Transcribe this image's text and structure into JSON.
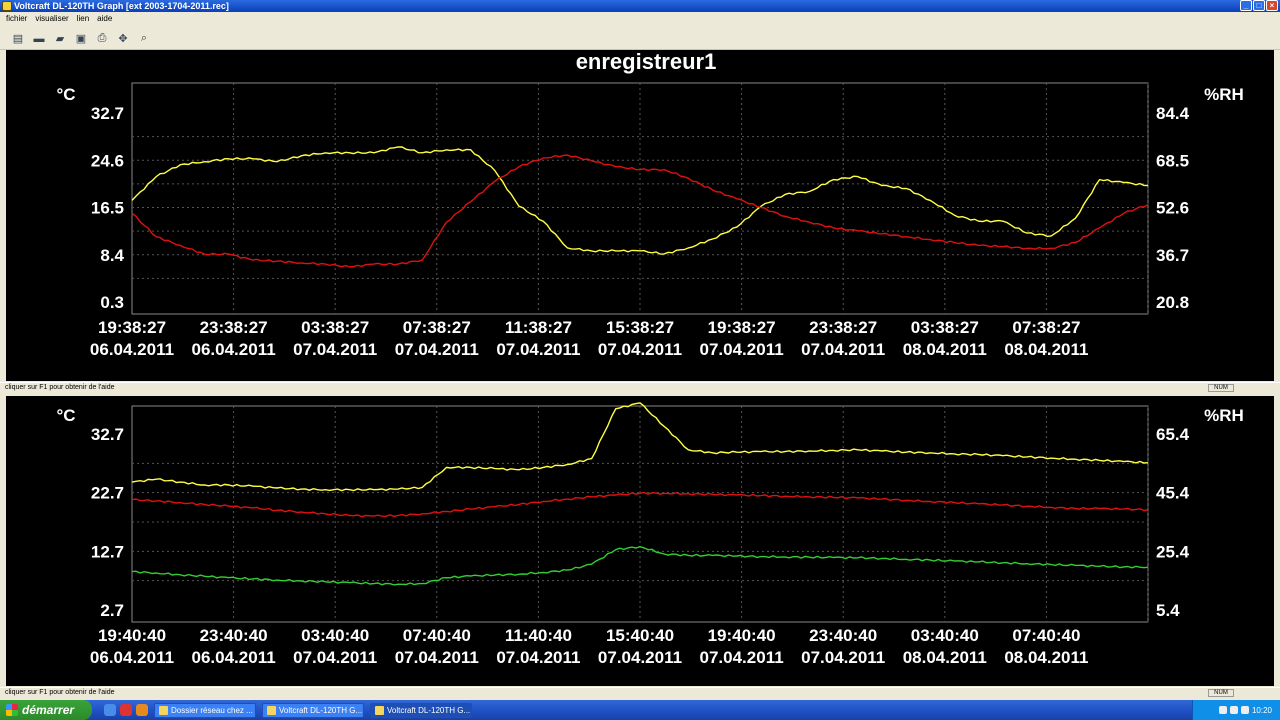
{
  "window": {
    "title": "Voltcraft DL-120TH Graph [ext 2003-1704-2011.rec]"
  },
  "menu": [
    "fichier",
    "visualiser",
    "lien",
    "aide"
  ],
  "toolbar": [
    {
      "name": "new-icon",
      "glyph": "▤"
    },
    {
      "name": "monitor-icon",
      "glyph": "▬"
    },
    {
      "name": "folder-open-icon",
      "glyph": "▰"
    },
    {
      "name": "save-icon",
      "glyph": "▣"
    },
    {
      "name": "print-icon",
      "glyph": "⎙"
    },
    {
      "name": "fit-icon",
      "glyph": "✥"
    },
    {
      "name": "zoom-icon",
      "glyph": "⌕"
    }
  ],
  "status": {
    "text": "cliquer sur F1 pour obtenir de l'aide",
    "num": "NUM"
  },
  "chart_data": [
    {
      "type": "line",
      "title": "enregistreur1",
      "ylabel": "°C",
      "y2label": "%RH",
      "ylim": [
        0.3,
        32.7
      ],
      "yticks": [
        "32.7",
        "24.6",
        "16.5",
        "8.4",
        "0.3"
      ],
      "y2lim": [
        20.8,
        84.4
      ],
      "y2ticks": [
        "84.4",
        "68.5",
        "52.6",
        "36.7",
        "20.8"
      ],
      "xticks": [
        [
          "19:38:27",
          "06.04.2011"
        ],
        [
          "23:38:27",
          "06.04.2011"
        ],
        [
          "03:38:27",
          "07.04.2011"
        ],
        [
          "07:38:27",
          "07.04.2011"
        ],
        [
          "11:38:27",
          "07.04.2011"
        ],
        [
          "15:38:27",
          "07.04.2011"
        ],
        [
          "19:38:27",
          "07.04.2011"
        ],
        [
          "23:38:27",
          "07.04.2011"
        ],
        [
          "03:38:27",
          "08.04.2011"
        ],
        [
          "07:38:27",
          "08.04.2011"
        ]
      ],
      "x": [
        0,
        1,
        2,
        3,
        4,
        5,
        6,
        7,
        8,
        9,
        10,
        11,
        12,
        13,
        14,
        15,
        16,
        17,
        18,
        19,
        20,
        21,
        22,
        23,
        24,
        25,
        26,
        27,
        28,
        29,
        30,
        31,
        32,
        33,
        34,
        35,
        36,
        37,
        38,
        39,
        40,
        41,
        42
      ],
      "series": [
        {
          "color": "#ffff40",
          "axis": "y2",
          "values": [
            55,
            63,
            67,
            68,
            69,
            69,
            68,
            70,
            71,
            71,
            71,
            73,
            71,
            72,
            72,
            65,
            53,
            48,
            39,
            38,
            38,
            38,
            37,
            39,
            42,
            46,
            53,
            57,
            58,
            62,
            63,
            60,
            59,
            55,
            50,
            48,
            48,
            44,
            43,
            49,
            62,
            61,
            60
          ]
        },
        {
          "color": "#e01010",
          "axis": "y",
          "values": [
            15.5,
            11.5,
            10,
            8.5,
            8.5,
            7.5,
            7.3,
            7.0,
            6.8,
            6.3,
            6.8,
            6.8,
            7.5,
            14,
            17.5,
            21,
            23.5,
            25,
            25.5,
            24.5,
            23.5,
            23,
            23,
            21.5,
            19.5,
            18,
            16.5,
            15,
            14,
            13,
            12.5,
            12,
            11.5,
            11,
            10.5,
            10,
            9.8,
            9.5,
            9.5,
            10.5,
            13,
            15.5,
            17
          ]
        }
      ]
    },
    {
      "type": "line",
      "ylabel": "°C",
      "y2label": "%RH",
      "ylim": [
        2.7,
        32.7
      ],
      "yticks": [
        "32.7",
        "22.7",
        "12.7",
        "2.7"
      ],
      "y2lim": [
        5.4,
        65.4
      ],
      "y2ticks": [
        "65.4",
        "45.4",
        "25.4",
        "5.4"
      ],
      "xticks": [
        [
          "19:40:40",
          "06.04.2011"
        ],
        [
          "23:40:40",
          "06.04.2011"
        ],
        [
          "03:40:40",
          "07.04.2011"
        ],
        [
          "07:40:40",
          "07.04.2011"
        ],
        [
          "11:40:40",
          "07.04.2011"
        ],
        [
          "15:40:40",
          "07.04.2011"
        ],
        [
          "19:40:40",
          "07.04.2011"
        ],
        [
          "23:40:40",
          "07.04.2011"
        ],
        [
          "03:40:40",
          "08.04.2011"
        ],
        [
          "07:40:40",
          "08.04.2011"
        ]
      ],
      "x": [
        0,
        1,
        2,
        3,
        4,
        5,
        6,
        7,
        8,
        9,
        10,
        11,
        12,
        13,
        14,
        15,
        16,
        17,
        18,
        19,
        20,
        21,
        22,
        23,
        24,
        25,
        26,
        27,
        28,
        29,
        30,
        31,
        32,
        33,
        34,
        35,
        36,
        37,
        38,
        39,
        40,
        41,
        42
      ],
      "series": [
        {
          "color": "#ffff40",
          "axis": "y",
          "values": [
            24.5,
            25,
            24.5,
            24,
            24,
            23.8,
            23.5,
            23.3,
            23.2,
            23.2,
            23.2,
            23.3,
            23.6,
            27,
            27,
            26.8,
            26.6,
            27,
            27.5,
            28.5,
            37,
            38,
            34,
            30,
            29.5,
            29.6,
            29.7,
            29.7,
            29.8,
            29.9,
            30,
            29.8,
            29.6,
            29.5,
            29.3,
            29.2,
            29.0,
            28.8,
            28.6,
            28.4,
            28.2,
            28.0,
            27.8
          ]
        },
        {
          "color": "#e01010",
          "axis": "y",
          "values": [
            21.5,
            21.3,
            21,
            20.7,
            20.4,
            20.1,
            19.7,
            19.4,
            19.1,
            18.8,
            18.7,
            18.8,
            19.1,
            19.5,
            19.9,
            20.3,
            20.7,
            21.2,
            21.6,
            22,
            22.3,
            22.6,
            22.6,
            22.5,
            22.4,
            22.3,
            22.2,
            22.1,
            22.0,
            21.9,
            21.8,
            21.6,
            21.4,
            21.2,
            21,
            20.8,
            20.6,
            20.4,
            20.2,
            20,
            20,
            19.9,
            19.8
          ]
        },
        {
          "color": "#30d030",
          "axis": "y2",
          "values": [
            18.5,
            18,
            17.4,
            16.9,
            16.4,
            16,
            15.6,
            15.3,
            15,
            14.7,
            14.4,
            14.2,
            14.4,
            16.4,
            17,
            17.3,
            17.6,
            18.2,
            19,
            21,
            26,
            27,
            24.5,
            24,
            24,
            23.8,
            23.6,
            23.5,
            23.4,
            23.3,
            23.2,
            23,
            22.7,
            22.4,
            22.1,
            21.8,
            21.5,
            21.2,
            20.9,
            20.6,
            20.3,
            20.1,
            20
          ]
        }
      ]
    }
  ],
  "taskbar": {
    "start": "démarrer",
    "items": [
      "Dossier réseau chez ...",
      "Voltcraft DL-120TH G...",
      "Voltcraft DL-120TH G..."
    ],
    "clock": "10:20"
  }
}
